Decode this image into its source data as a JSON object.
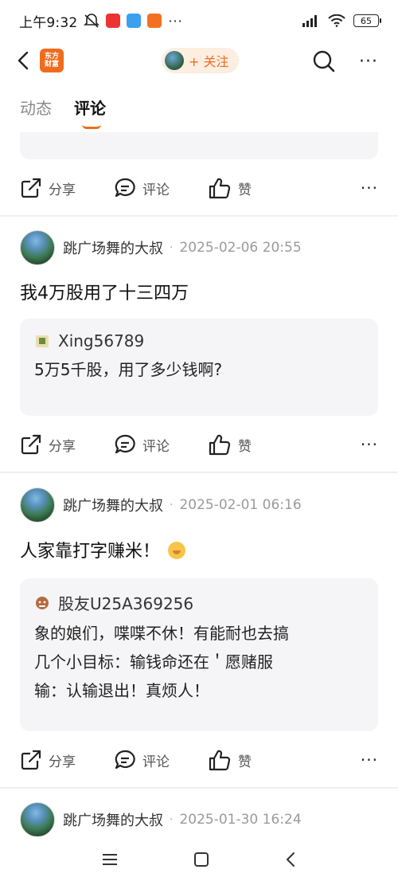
{
  "status_bar": {
    "time": "上午9:32",
    "battery": "65"
  },
  "nav": {
    "app_logo_line1": "东方",
    "app_logo_line2": "财富",
    "follow_label": "+ 关注"
  },
  "tabs": [
    {
      "label": "动态",
      "active": false
    },
    {
      "label": "评论",
      "active": true
    }
  ],
  "actions": {
    "share": "分享",
    "comment": "评论",
    "like": "赞"
  },
  "comments": [
    {
      "author": "跳广场舞的大叔",
      "time": "2025-02-06 20:55",
      "text": "我4万股用了十三四万",
      "quote": {
        "user": "Xing56789",
        "text": "5万5千股，用了多少钱啊?"
      }
    },
    {
      "author": "跳广场舞的大叔",
      "time": "2025-02-01 06:16",
      "text": "人家靠打字赚米！",
      "quote": {
        "user": "股友U25A369256",
        "text_lines": [
          "象的娘们，喋喋不休！有能耐也去搞",
          "几个小目标：输钱命还在＇愿赌服",
          "输：认输退出！真烦人！"
        ]
      }
    },
    {
      "author": "跳广场舞的大叔",
      "time": "2025-01-30 16:24"
    }
  ],
  "colors": {
    "accent": "#ef6c1c",
    "quote_bg": "#f5f5f7",
    "muted_text": "#9a9a9a"
  }
}
